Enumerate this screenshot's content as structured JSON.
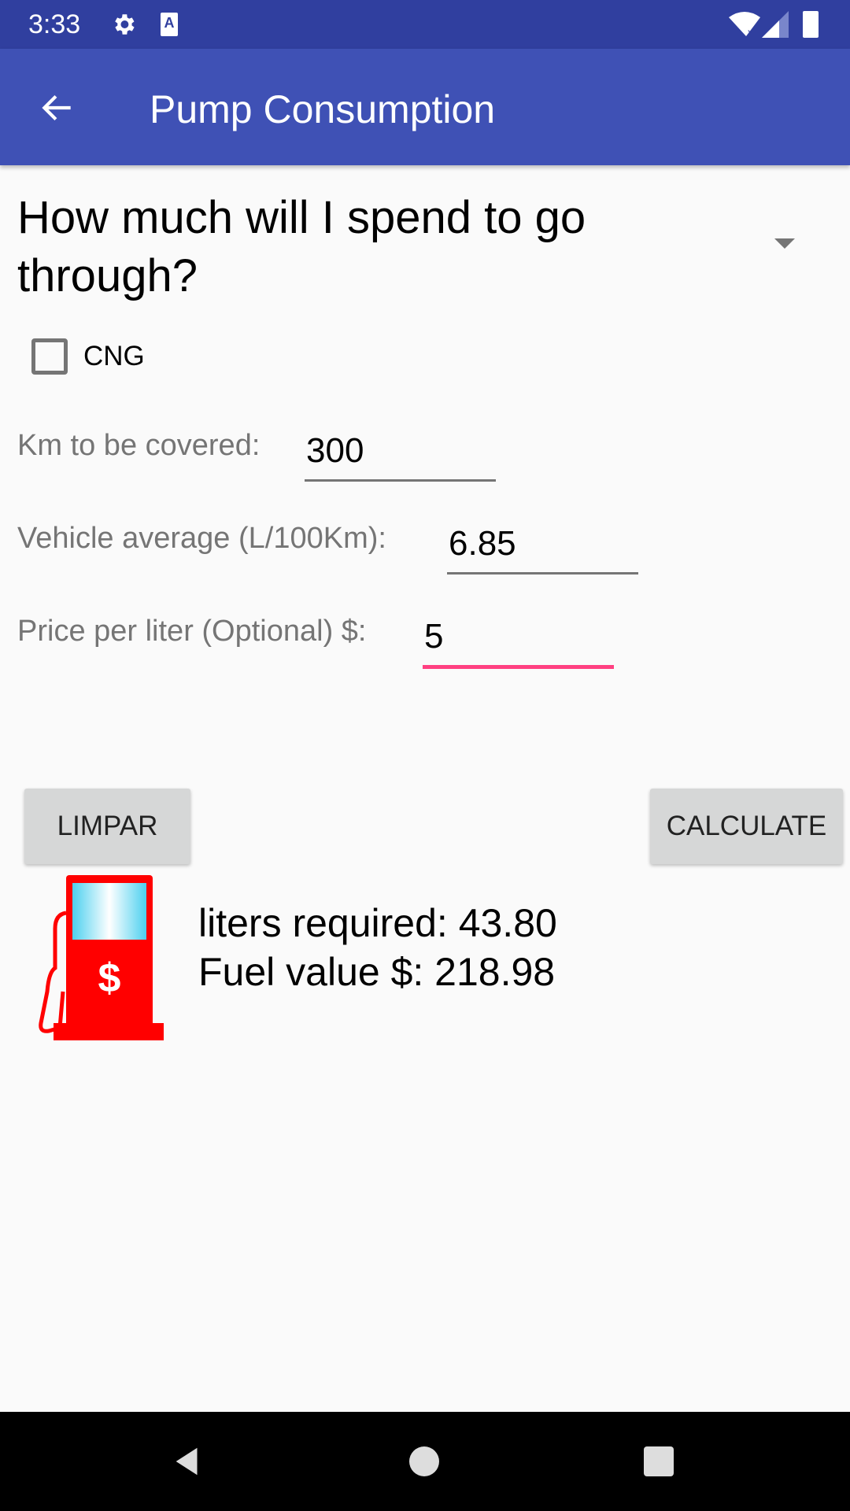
{
  "status_bar": {
    "time": "3:33",
    "icons": [
      "settings-icon",
      "a11y-icon",
      "wifi-icon",
      "signal-icon",
      "battery-icon"
    ]
  },
  "app_bar": {
    "title": "Pump Consumption",
    "back_icon": "arrow-back-icon"
  },
  "question": {
    "text": "How much will I spend to go through?",
    "dropdown_icon": "dropdown-arrow-icon"
  },
  "cng_checkbox": {
    "label": "CNG",
    "checked": false
  },
  "fields": [
    {
      "label": "Km to be covered:",
      "value": "300"
    },
    {
      "label": "Vehicle average (L/100Km):",
      "value": "6.85"
    },
    {
      "label": "Price per liter (Optional) $:",
      "value": "5"
    }
  ],
  "buttons": {
    "clear": "LIMPAR",
    "calculate": "CALCULATE"
  },
  "results": {
    "liters": "liters required:  43.80",
    "fuel_value": "Fuel value $: 218.98"
  },
  "colors": {
    "primary": "#3f51b5",
    "primary_dark": "#303f9f",
    "accent": "#ff4081",
    "pump": "#ff0000"
  }
}
